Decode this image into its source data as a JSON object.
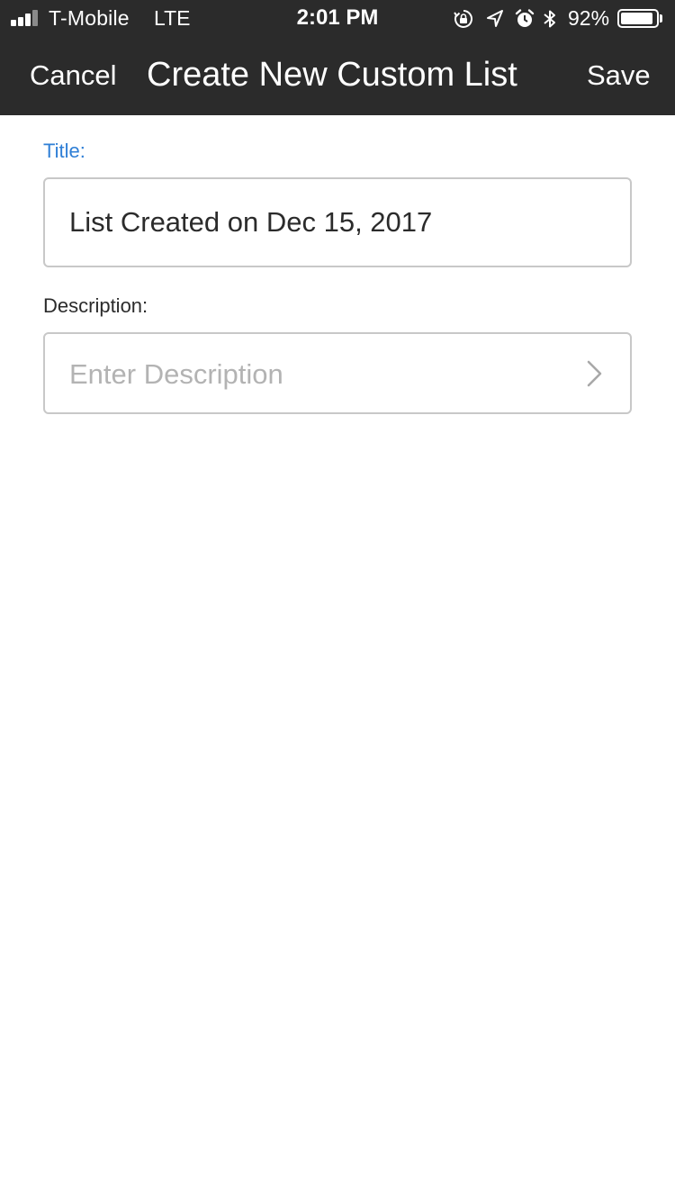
{
  "status_bar": {
    "carrier": "T-Mobile",
    "network": "LTE",
    "time": "2:01 PM",
    "battery_percent": "92%",
    "battery_level": 0.92,
    "icons": [
      "signal-icon",
      "rotation-lock-icon",
      "location-arrow-icon",
      "alarm-icon",
      "bluetooth-icon",
      "battery-icon"
    ]
  },
  "nav": {
    "cancel_label": "Cancel",
    "title": "Create New Custom List",
    "save_label": "Save",
    "background": "#2b2b2b"
  },
  "form": {
    "title_label": "Title:",
    "title_value": "List Created on Dec 15, 2017",
    "description_label": "Description:",
    "description_placeholder": "Enter Description",
    "accent_color": "#2f7fd6"
  }
}
